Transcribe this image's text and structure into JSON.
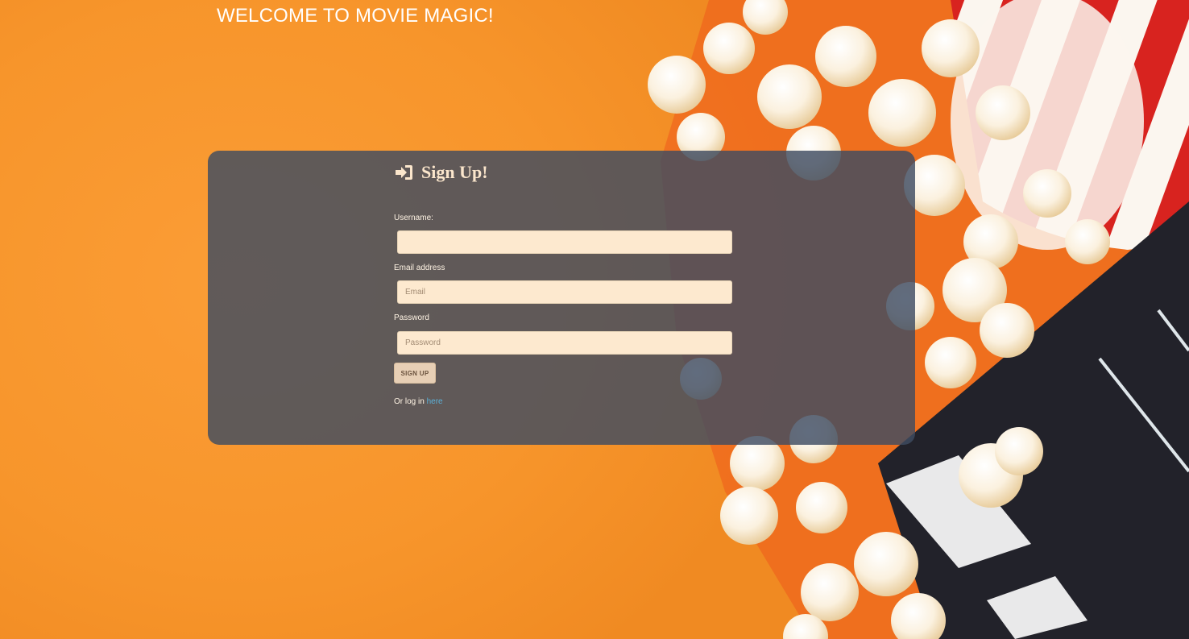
{
  "header": {
    "title": "WELCOME TO MOVIE MAGIC!"
  },
  "signup": {
    "title": "Sign Up!",
    "title_icon": "sign-in-icon",
    "username_label": "Username:",
    "username_value": "",
    "email_label": "Email address",
    "email_placeholder": "Email",
    "password_label": "Password",
    "password_placeholder": "Password",
    "submit_label": "SIGN UP",
    "login_prompt": "Or log in",
    "login_link_label": "here"
  },
  "colors": {
    "background": "#f7952b",
    "panel": "#3e4c62",
    "input_background": "#fde9cf",
    "link": "#5bb0d8"
  }
}
